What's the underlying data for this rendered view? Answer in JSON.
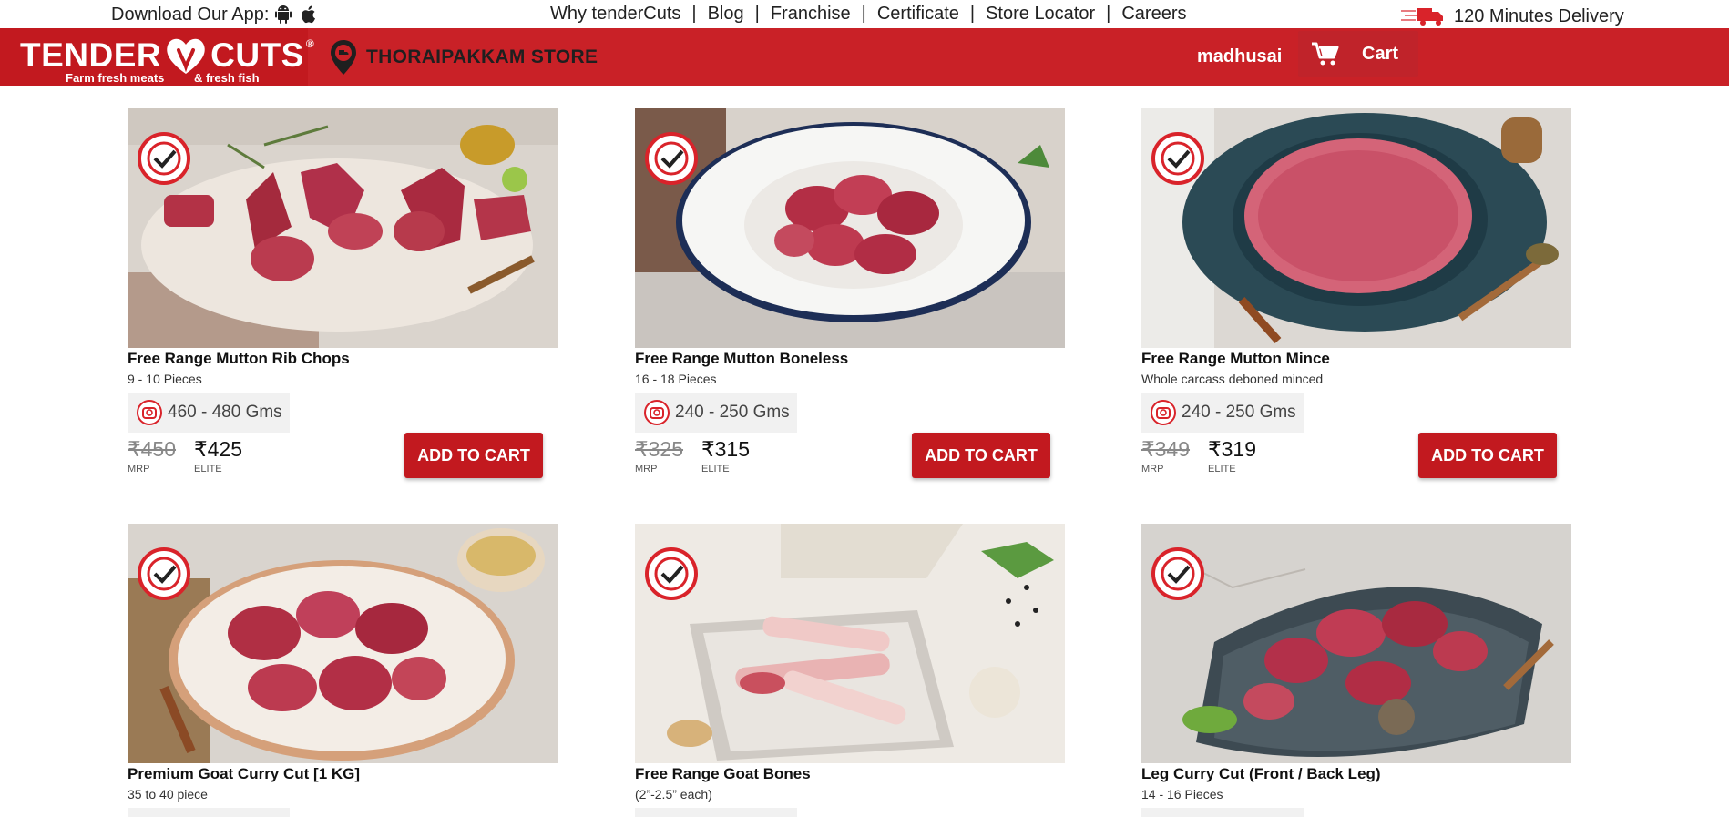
{
  "topbar": {
    "download_label": "Download Our App:",
    "nav": [
      "Why tenderCuts",
      "Blog",
      "Franchise",
      "Certificate",
      "Store Locator",
      "Careers"
    ],
    "nav_separator": "|",
    "delivery": "120 Minutes Delivery"
  },
  "header": {
    "brand_left": "TENDER",
    "brand_right": "CUTS",
    "brand_mark": "®",
    "tagline_left": "Farm fresh meats",
    "tagline_right": "& fresh fish",
    "store_name": "THORAIPAKKAM STORE",
    "user": "madhusai",
    "cart_label": "Cart"
  },
  "products": [
    {
      "title": "Free Range Mutton Rib Chops",
      "sub": "9 - 10 Pieces",
      "weight": "460 - 480 Gms",
      "mrp": "₹450",
      "elite": "₹425",
      "mrp_label": "MRP",
      "elite_label": "ELITE",
      "button": "ADD TO CART"
    },
    {
      "title": "Free Range Mutton Boneless",
      "sub": "16 - 18 Pieces",
      "weight": "240 - 250 Gms",
      "mrp": "₹325",
      "elite": "₹315",
      "mrp_label": "MRP",
      "elite_label": "ELITE",
      "button": "ADD TO CART"
    },
    {
      "title": "Free Range Mutton Mince",
      "sub": "Whole carcass deboned minced",
      "weight": "240 - 250 Gms",
      "mrp": "₹349",
      "elite": "₹319",
      "mrp_label": "MRP",
      "elite_label": "ELITE",
      "button": "ADD TO CART"
    },
    {
      "title": "Premium Goat Curry Cut [1 KG]",
      "sub": "35 to 40 piece",
      "weight": "",
      "mrp": "",
      "elite": "",
      "mrp_label": "",
      "elite_label": "",
      "button": ""
    },
    {
      "title": "Free Range Goat Bones",
      "sub": "(2”-2.5” each)",
      "weight": "",
      "mrp": "",
      "elite": "",
      "mrp_label": "",
      "elite_label": "",
      "button": ""
    },
    {
      "title": "Leg Curry Cut (Front / Back Leg)",
      "sub": "14 - 16 Pieces",
      "weight": "",
      "mrp": "",
      "elite": "",
      "mrp_label": "",
      "elite_label": "",
      "button": ""
    }
  ],
  "colors": {
    "brand_red": "#c92127",
    "button_red": "#c2191f",
    "weight_bg": "#f1f1f1"
  },
  "icons": {
    "android": "android-icon",
    "apple": "apple-icon",
    "pin": "location-pin-icon",
    "cart": "shopping-cart-icon",
    "badge": "antibiotic-free-badge-icon",
    "scale": "weighing-scale-icon"
  }
}
